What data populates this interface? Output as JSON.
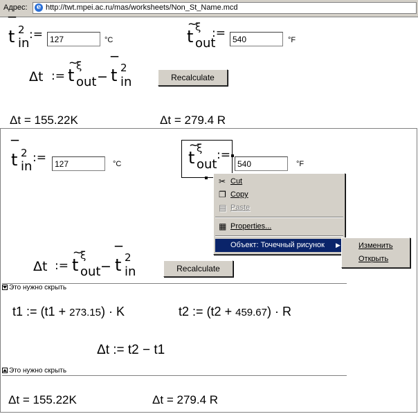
{
  "address_bar": {
    "label": "Адрес:",
    "url": "http://twt.mpei.ac.ru/mas/worksheets/Non_St_Name.mcd"
  },
  "worksheet": {
    "var_t_in": {
      "base": "t",
      "sup": "2",
      "sub": "in"
    },
    "var_t_out": {
      "base": "t",
      "sup": "ξ",
      "sub": "out"
    },
    "assign": ":=",
    "t_in_value": "127",
    "t_in_unit": "°C",
    "t_out_value": "540",
    "t_out_unit": "°F",
    "delta": "Δt",
    "minus": "−",
    "recalc_label": "Recalculate",
    "result_K": {
      "lhs": "Δt",
      "eq": "=",
      "value": "155.22",
      "unit": "K"
    },
    "result_R": {
      "lhs": "Δt",
      "eq": "=",
      "value": "279.4",
      "unit": "R"
    },
    "hidden_label": "Это нужно скрыть",
    "t1_formula": {
      "lhs": "t1",
      "assign": ":=",
      "open": "(t1 +",
      "num": "273.15",
      "close": ") ·",
      "unit": "K"
    },
    "t2_formula": {
      "lhs": "t2",
      "assign": ":=",
      "open": "(t2 +",
      "num": "459.67",
      "close": ") ·",
      "unit": "R"
    },
    "dt_formula": "Δt := t2 − t1"
  },
  "context_menu": {
    "cut": "Cut",
    "copy": "Copy",
    "paste": "Paste",
    "properties": "Properties...",
    "object": "Объект: Точечный рисунок",
    "submenu": {
      "edit": "Изменить",
      "open": "Открыть"
    }
  }
}
